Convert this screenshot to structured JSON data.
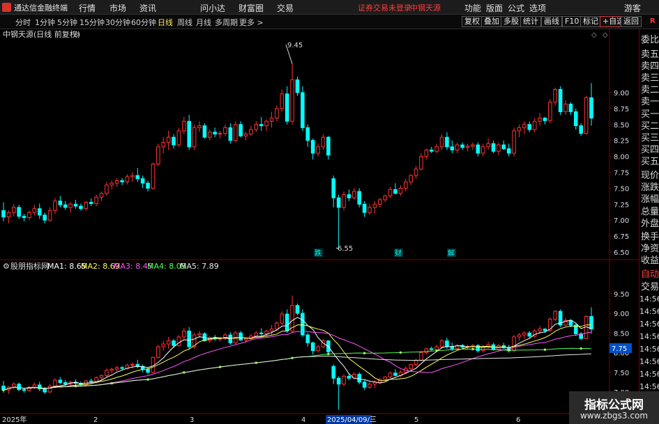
{
  "app": {
    "title": "通达信金融终端",
    "menu": [
      "行情",
      "市场",
      "资讯",
      "问小达",
      "财富圈",
      "交易"
    ],
    "broker_status": "证券交易未登录",
    "stock_name": "中钢天源",
    "right_menu": [
      "功能",
      "版面",
      "公式",
      "选项"
    ],
    "guest": "游客"
  },
  "period_tabs": [
    {
      "label": "分时",
      "active": false
    },
    {
      "label": "1分钟",
      "active": false
    },
    {
      "label": "5分钟",
      "active": false
    },
    {
      "label": "15分钟",
      "active": false
    },
    {
      "label": "30分钟",
      "active": false
    },
    {
      "label": "60分钟",
      "active": false
    },
    {
      "label": "日线",
      "active": true
    },
    {
      "label": "周线",
      "active": false
    },
    {
      "label": "月线",
      "active": false
    },
    {
      "label": "多周期",
      "active": false
    },
    {
      "label": "更多 >",
      "active": false
    }
  ],
  "toolbar": [
    {
      "label": "复权",
      "active": false
    },
    {
      "label": "叠加",
      "active": false
    },
    {
      "label": "多股",
      "active": false
    },
    {
      "label": "统计",
      "active": false
    },
    {
      "label": "画线",
      "active": false
    },
    {
      "label": "F10",
      "active": false
    },
    {
      "label": "标记",
      "active": false
    },
    {
      "label": "+自选",
      "active": true
    },
    {
      "label": "返回",
      "active": false
    }
  ],
  "r_badge": "R",
  "main_chart": {
    "title": "中钢天源(日线 前复权)",
    "high_label": "9.45",
    "low_label": "6.55",
    "event_markers": [
      "跌",
      "财",
      "解"
    ],
    "y_ticks": [
      "9.00",
      "8.75",
      "8.50",
      "8.25",
      "8.00",
      "7.75",
      "7.50",
      "7.25",
      "7.00",
      "6.75",
      "6.50"
    ]
  },
  "indicator": {
    "name": "股朋指标网",
    "ma": [
      {
        "label": "MA1: 8.65",
        "color": "#ffffff"
      },
      {
        "label": "MA2: 8.69",
        "color": "#ffff55"
      },
      {
        "label": "MA3: 8.45",
        "color": "#ff55ff"
      },
      {
        "label": "MA4: 8.05",
        "color": "#55ff55"
      },
      {
        "label": "MA5: 7.89",
        "color": "#e8e8e8"
      }
    ],
    "y_ticks": [
      "9.50",
      "9.00",
      "8.50",
      "8.00",
      "7.50",
      "7.00"
    ],
    "current_value": "7.75"
  },
  "date_axis": [
    "2025年",
    "2",
    "3",
    "4",
    "2025/04/09/三",
    "5",
    "6"
  ],
  "side_panel": {
    "quote_labels": [
      "委比",
      "卖五",
      "卖四",
      "卖三",
      "卖二",
      "卖一",
      "买一",
      "买二",
      "买三",
      "买四",
      "买五",
      "现价",
      "涨跌",
      "涨幅",
      "总量",
      "外盘",
      "换手",
      "净资",
      "收益"
    ],
    "trade_labels": [
      "自动",
      "交易"
    ],
    "times": [
      "14:56",
      "14:56",
      "14:56",
      "14:56",
      "14:56",
      "14:56",
      "14:56",
      "14:56"
    ]
  },
  "watermark": {
    "title": "指标公式网",
    "url": "www.zbgs3.com"
  },
  "colors": {
    "up": "#ff3232",
    "down": "#00ffff",
    "grid": "#800000",
    "accent": "#ffe45a"
  },
  "chart_data": {
    "type": "candlestick",
    "title": "中钢天源(日线 前复权)",
    "ylim": [
      6.45,
      9.6
    ],
    "series_hint": "daily OHLC, approx. Jan 2025 - Jun 2025",
    "ohlc": [
      [
        7.15,
        7.28,
        6.98,
        7.05
      ],
      [
        7.05,
        7.15,
        6.95,
        7.12
      ],
      [
        7.12,
        7.25,
        7.06,
        7.2
      ],
      [
        7.2,
        7.24,
        7.02,
        7.06
      ],
      [
        7.06,
        7.1,
        6.98,
        7.04
      ],
      [
        7.04,
        7.15,
        7.0,
        7.12
      ],
      [
        7.12,
        7.24,
        7.08,
        7.18
      ],
      [
        7.18,
        7.26,
        7.02,
        7.08
      ],
      [
        7.08,
        7.12,
        6.95,
        7.0
      ],
      [
        7.0,
        7.2,
        6.98,
        7.15
      ],
      [
        7.15,
        7.35,
        7.1,
        7.3
      ],
      [
        7.3,
        7.38,
        7.2,
        7.24
      ],
      [
        7.24,
        7.3,
        7.16,
        7.2
      ],
      [
        7.2,
        7.28,
        7.12,
        7.25
      ],
      [
        7.25,
        7.32,
        7.18,
        7.22
      ],
      [
        7.22,
        7.26,
        7.15,
        7.18
      ],
      [
        7.18,
        7.3,
        7.15,
        7.28
      ],
      [
        7.28,
        7.34,
        7.22,
        7.26
      ],
      [
        7.26,
        7.4,
        7.22,
        7.36
      ],
      [
        7.36,
        7.45,
        7.3,
        7.42
      ],
      [
        7.42,
        7.6,
        7.38,
        7.55
      ],
      [
        7.55,
        7.62,
        7.48,
        7.58
      ],
      [
        7.58,
        7.66,
        7.52,
        7.62
      ],
      [
        7.62,
        7.66,
        7.55,
        7.6
      ],
      [
        7.6,
        7.72,
        7.56,
        7.68
      ],
      [
        7.68,
        7.75,
        7.6,
        7.7
      ],
      [
        7.7,
        7.82,
        7.6,
        7.65
      ],
      [
        7.65,
        7.7,
        7.5,
        7.58
      ],
      [
        7.58,
        7.62,
        7.45,
        7.5
      ],
      [
        7.5,
        7.9,
        7.48,
        7.88
      ],
      [
        7.88,
        8.2,
        7.85,
        8.15
      ],
      [
        8.15,
        8.3,
        8.05,
        8.22
      ],
      [
        8.22,
        8.4,
        8.1,
        8.3
      ],
      [
        8.3,
        8.35,
        8.12,
        8.18
      ],
      [
        8.18,
        8.45,
        8.15,
        8.4
      ],
      [
        8.4,
        8.62,
        8.35,
        8.55
      ],
      [
        8.55,
        8.65,
        8.1,
        8.15
      ],
      [
        8.15,
        8.5,
        8.1,
        8.45
      ],
      [
        8.45,
        8.55,
        8.38,
        8.48
      ],
      [
        8.48,
        8.52,
        8.28,
        8.3
      ],
      [
        8.3,
        8.42,
        8.25,
        8.38
      ],
      [
        8.38,
        8.45,
        8.3,
        8.35
      ],
      [
        8.35,
        8.4,
        8.28,
        8.36
      ],
      [
        8.36,
        8.5,
        8.32,
        8.45
      ],
      [
        8.45,
        8.52,
        8.2,
        8.25
      ],
      [
        8.25,
        8.55,
        8.22,
        8.5
      ],
      [
        8.5,
        8.55,
        8.3,
        8.32
      ],
      [
        8.32,
        8.38,
        8.25,
        8.35
      ],
      [
        8.35,
        8.48,
        8.32,
        8.42
      ],
      [
        8.42,
        8.55,
        8.38,
        8.5
      ],
      [
        8.5,
        8.62,
        8.4,
        8.48
      ],
      [
        8.48,
        8.58,
        8.4,
        8.55
      ],
      [
        8.55,
        8.7,
        8.45,
        8.6
      ],
      [
        8.6,
        8.8,
        8.55,
        8.75
      ],
      [
        8.75,
        9.05,
        8.7,
        8.98
      ],
      [
        8.98,
        9.1,
        8.5,
        8.55
      ],
      [
        8.55,
        9.45,
        8.5,
        9.2
      ],
      [
        9.2,
        9.25,
        8.95,
        9.0
      ],
      [
        9.0,
        9.1,
        8.4,
        8.45
      ],
      [
        8.45,
        8.5,
        8.15,
        8.25
      ],
      [
        8.25,
        8.28,
        7.95,
        8.05
      ],
      [
        8.05,
        8.2,
        8.0,
        8.15
      ],
      [
        8.15,
        8.35,
        8.1,
        8.3
      ],
      [
        8.3,
        8.32,
        7.95,
        8.02
      ],
      [
        7.65,
        7.7,
        7.2,
        7.35
      ],
      [
        7.35,
        7.4,
        6.55,
        7.2
      ],
      [
        7.2,
        7.45,
        7.15,
        7.4
      ],
      [
        7.4,
        7.48,
        7.3,
        7.35
      ],
      [
        7.35,
        7.5,
        7.32,
        7.45
      ],
      [
        7.45,
        7.5,
        7.2,
        7.25
      ],
      [
        7.25,
        7.3,
        7.05,
        7.12
      ],
      [
        7.12,
        7.25,
        7.08,
        7.2
      ],
      [
        7.2,
        7.3,
        7.1,
        7.25
      ],
      [
        7.25,
        7.35,
        7.2,
        7.32
      ],
      [
        7.32,
        7.4,
        7.28,
        7.38
      ],
      [
        7.38,
        7.52,
        7.35,
        7.48
      ],
      [
        7.48,
        7.58,
        7.4,
        7.42
      ],
      [
        7.42,
        7.55,
        7.38,
        7.5
      ],
      [
        7.5,
        7.65,
        7.45,
        7.6
      ],
      [
        7.6,
        7.72,
        7.55,
        7.7
      ],
      [
        7.7,
        7.85,
        7.65,
        7.8
      ],
      [
        7.8,
        8.05,
        7.78,
        8.0
      ],
      [
        8.0,
        8.12,
        7.95,
        8.1
      ],
      [
        8.1,
        8.15,
        8.05,
        8.08
      ],
      [
        8.08,
        8.2,
        8.05,
        8.15
      ],
      [
        8.15,
        8.35,
        8.1,
        8.3
      ],
      [
        8.3,
        8.38,
        8.1,
        8.15
      ],
      [
        8.15,
        8.25,
        8.05,
        8.1
      ],
      [
        8.1,
        8.22,
        8.05,
        8.18
      ],
      [
        8.18,
        8.22,
        8.1,
        8.14
      ],
      [
        8.14,
        8.2,
        8.08,
        8.16
      ],
      [
        8.16,
        8.22,
        8.1,
        8.18
      ],
      [
        8.18,
        8.22,
        8.0,
        8.05
      ],
      [
        8.05,
        8.2,
        8.0,
        8.15
      ],
      [
        8.15,
        8.28,
        8.1,
        8.2
      ],
      [
        8.2,
        8.25,
        8.05,
        8.08
      ],
      [
        8.08,
        8.22,
        8.02,
        8.18
      ],
      [
        8.18,
        8.25,
        8.1,
        8.12
      ],
      [
        8.12,
        8.2,
        8.0,
        8.05
      ],
      [
        8.05,
        8.45,
        8.0,
        8.4
      ],
      [
        8.4,
        8.5,
        8.3,
        8.45
      ],
      [
        8.45,
        8.55,
        8.35,
        8.5
      ],
      [
        8.5,
        8.55,
        8.38,
        8.42
      ],
      [
        8.42,
        8.6,
        8.38,
        8.55
      ],
      [
        8.55,
        8.68,
        8.48,
        8.6
      ],
      [
        8.6,
        8.62,
        8.5,
        8.56
      ],
      [
        8.56,
        8.9,
        8.52,
        8.85
      ],
      [
        8.85,
        9.08,
        8.8,
        9.05
      ],
      [
        9.05,
        9.1,
        8.65,
        8.7
      ],
      [
        8.7,
        8.88,
        8.65,
        8.82
      ],
      [
        8.82,
        8.85,
        8.65,
        8.7
      ],
      [
        8.7,
        8.75,
        8.42,
        8.48
      ],
      [
        8.48,
        8.52,
        8.32,
        8.36
      ],
      [
        8.36,
        8.95,
        8.34,
        8.92
      ],
      [
        8.92,
        9.15,
        8.48,
        8.6
      ]
    ]
  }
}
